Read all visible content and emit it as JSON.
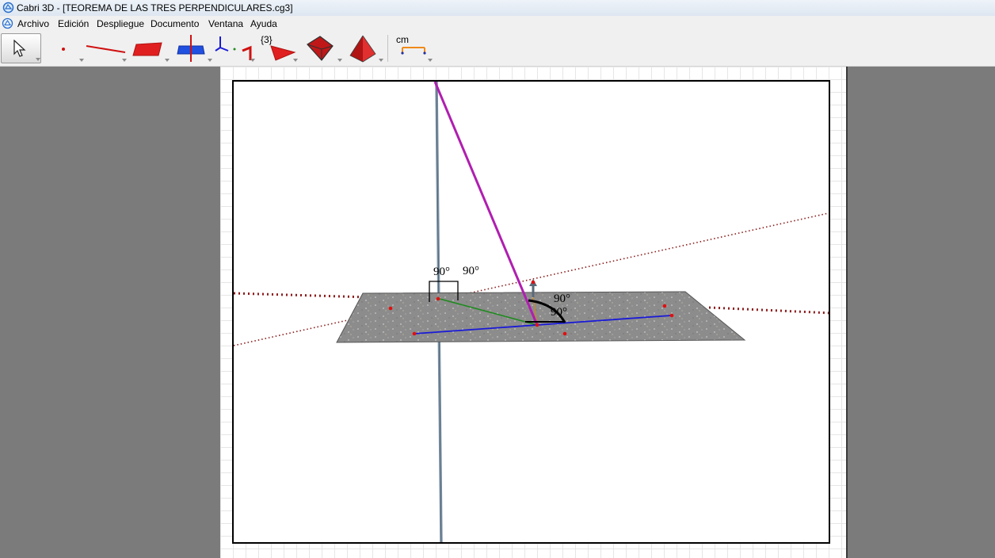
{
  "window": {
    "title": "Cabri 3D - [TEOREMA DE LAS TRES PERPENDICULARES.cg3]"
  },
  "menu": {
    "items": [
      "Archivo",
      "Edición",
      "Despliegue",
      "Documento",
      "Ventana",
      "Ayuda"
    ]
  },
  "toolbar": {
    "tools": [
      "select-tool",
      "point-tool",
      "curve-tool",
      "surface-tool",
      "relative-construction-tool",
      "transformation-tool",
      "regular-polygon-tool",
      "polyhedron-tool",
      "regular-polyhedron-tool",
      "measure-tool"
    ],
    "polygon_label": "{3}",
    "measure_label": "cm"
  },
  "canvas": {
    "angle_labels": [
      "90°",
      "90°",
      "90°",
      "90°"
    ]
  },
  "colors": {
    "oblique_segment": "#b01eb0",
    "perpendicular_line": "#7f95a8",
    "plane": "#8c8c8c",
    "blue_line": "#1a1ad8",
    "green_segment": "#1f8a1f",
    "dotted_lines": "#8a1a1a",
    "points": "#e01010"
  }
}
